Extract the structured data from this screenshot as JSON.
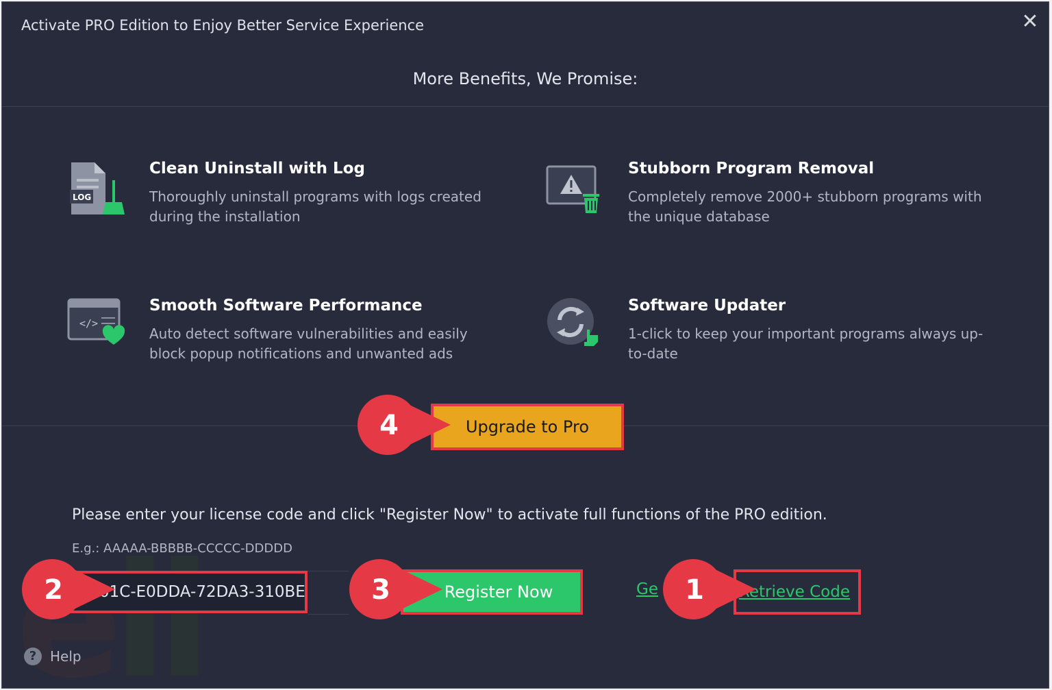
{
  "window": {
    "title": "Activate PRO Edition to Enjoy Better Service Experience"
  },
  "header": {
    "text": "More Benefits, We Promise:"
  },
  "features": [
    {
      "title": "Clean Uninstall with Log",
      "description": "Thoroughly uninstall programs with logs created during the installation",
      "icon": "log-broom-icon",
      "icon_label": "LOG"
    },
    {
      "title": "Stubborn Program Removal",
      "description": "Completely remove 2000+ stubborn programs with the unique database",
      "icon": "warning-trash-icon"
    },
    {
      "title": "Smooth Software Performance",
      "description": "Auto detect software vulnerabilities and easily block popup notifications and unwanted ads",
      "icon": "code-window-heart-icon",
      "icon_label": "</>"
    },
    {
      "title": "Software Updater",
      "description": "1-click to keep your important programs always up-to-date",
      "icon": "refresh-hand-icon"
    }
  ],
  "upgrade_button": {
    "label": "Upgrade to Pro"
  },
  "license": {
    "instruction": "Please enter your license code and click \"Register Now\" to activate full functions of the PRO edition.",
    "example": "E.g.: AAAAA-BBBBB-CCCCC-DDDDD",
    "value": "01C-E0DDA-72DA3-310BE"
  },
  "register_button": {
    "label": "Register Now"
  },
  "get_link": {
    "label": "Ge"
  },
  "retrieve_link": {
    "label": "Retrieve Code"
  },
  "help": {
    "label": "Help",
    "icon": "question-icon"
  },
  "close": {
    "icon": "close-icon",
    "glyph": "✕"
  },
  "callouts": [
    {
      "number": "1",
      "target": "retrieve-code"
    },
    {
      "number": "2",
      "target": "license-input"
    },
    {
      "number": "3",
      "target": "register-now"
    },
    {
      "number": "4",
      "target": "upgrade-to-pro"
    }
  ],
  "watermark": {
    "text": "ecll"
  },
  "colors": {
    "background": "#272b3c",
    "accent_green": "#2dc76b",
    "upgrade_orange": "#e9a51d",
    "callout_red": "#e63946"
  }
}
